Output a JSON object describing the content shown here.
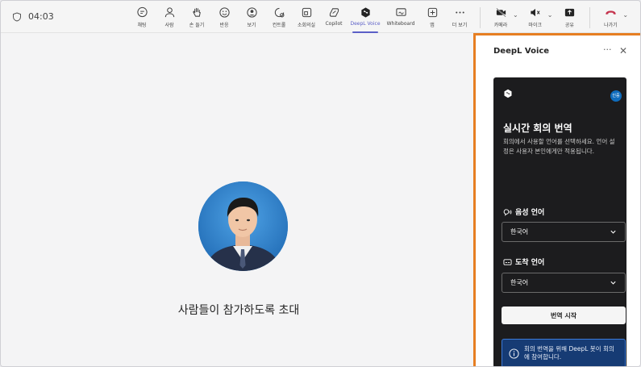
{
  "meeting": {
    "timer": "04:03"
  },
  "toolbar": {
    "items": [
      {
        "label": "채팅",
        "icon": "chat-icon"
      },
      {
        "label": "사람",
        "icon": "people-icon"
      },
      {
        "label": "손 들기",
        "icon": "raise-hand-icon"
      },
      {
        "label": "반응",
        "icon": "reaction-icon"
      },
      {
        "label": "보기",
        "icon": "view-icon"
      },
      {
        "label": "컨트롤",
        "icon": "controls-icon"
      },
      {
        "label": "소회의실",
        "icon": "breakout-rooms-icon"
      },
      {
        "label": "Copilot",
        "icon": "copilot-icon"
      },
      {
        "label": "DeepL Voice",
        "icon": "deepl-icon"
      },
      {
        "label": "Whiteboard",
        "icon": "whiteboard-icon"
      },
      {
        "label": "앱",
        "icon": "apps-icon"
      },
      {
        "label": "더 보기",
        "icon": "more-icon"
      }
    ],
    "camera_label": "카메라",
    "mic_label": "마이크",
    "share_label": "공유",
    "leave_label": "나가기"
  },
  "stage": {
    "invite_text": "사람들이 참가하도록 초대"
  },
  "panel": {
    "title": "DeepL Voice",
    "badge": "인증",
    "heading": "실시간 회의 번역",
    "description": "회의에서 사용할 언어를 선택하세요. 언어 설정은 사용자 본인에게만 적용됩니다.",
    "speech_label": "음성 언어",
    "speech_value": "한국어",
    "target_label": "도착 언어",
    "target_value": "한국어",
    "start_button": "번역 시작",
    "info_text": "회의 번역을 위해 DeepL 봇이 회의에 참여합니다."
  },
  "colors": {
    "accent": "#5b5fc7",
    "highlight": "#e67e22",
    "leave": "#c4314b",
    "info_bg": "#163b74"
  }
}
